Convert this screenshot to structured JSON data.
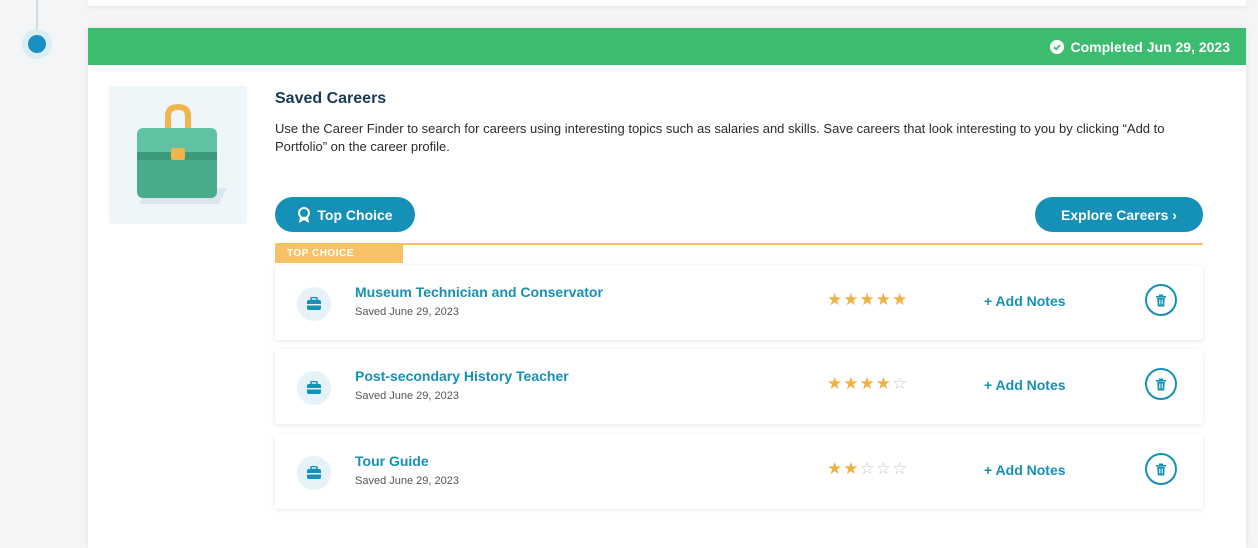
{
  "status": {
    "label": "Completed Jun 29, 2023",
    "color": "#3cbc6f",
    "icon": "check-circle-icon"
  },
  "section": {
    "title": "Saved Careers",
    "description": "Use the Career Finder to search for careers using interesting topics such as salaries and skills. Save careers that look interesting to you by clicking “Add to Portfolio” on the career profile.",
    "illustration": "briefcase-illustration"
  },
  "buttons": {
    "top_choice": "Top Choice",
    "explore": "Explore Careers ›"
  },
  "list": {
    "top_choice_tag": "TOP CHOICE",
    "careers": [
      {
        "name": "Museum Technician and Conservator",
        "saved": "Saved June 29, 2023",
        "rating": 5,
        "notes_label": "+ Add Notes"
      },
      {
        "name": "Post-secondary History Teacher",
        "saved": "Saved June 29, 2023",
        "rating": 4,
        "notes_label": "+ Add Notes"
      },
      {
        "name": "Tour Guide",
        "saved": "Saved June 29, 2023",
        "rating": 2,
        "notes_label": "+ Add Notes"
      }
    ]
  },
  "colors": {
    "accent": "#1590b7",
    "star": "#f1b142",
    "tag": "#f6c265"
  }
}
